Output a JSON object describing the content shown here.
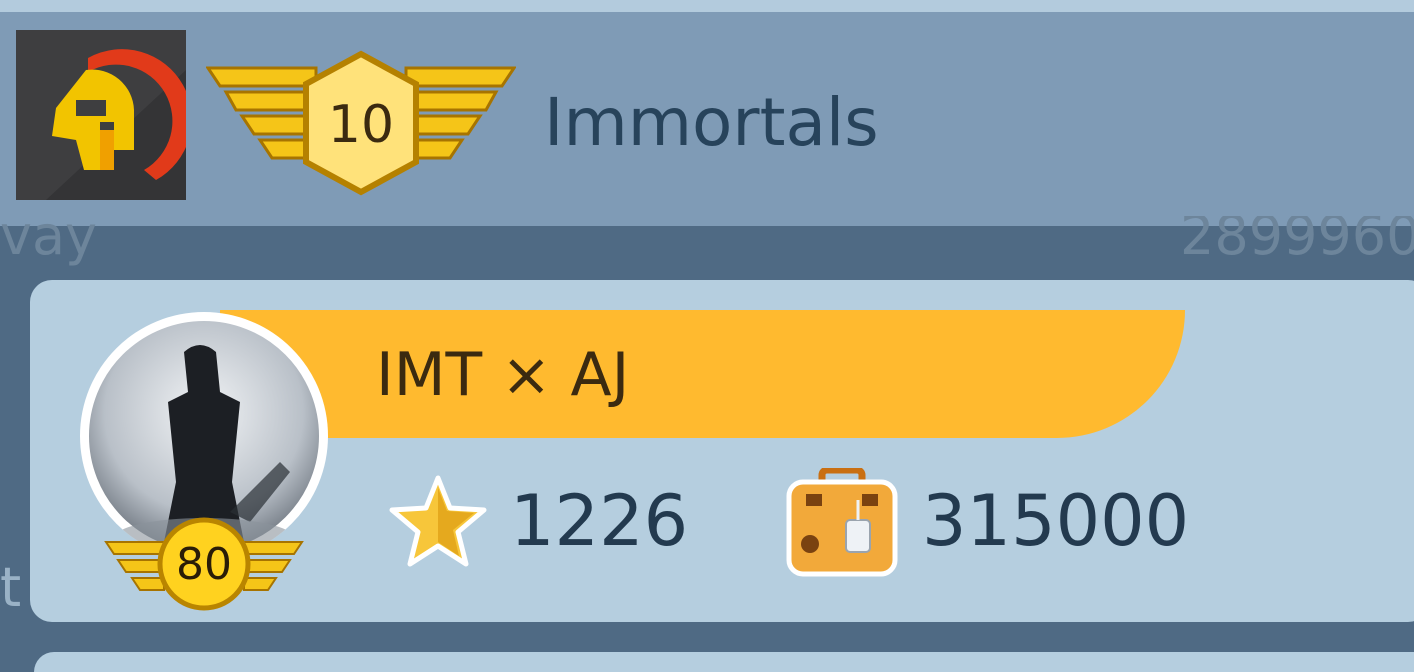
{
  "team": {
    "name": "Immortals",
    "level": "10",
    "logo_icon": "spartan-helmet-icon"
  },
  "background_text": {
    "left": "vay",
    "right": "2899960",
    "left_lower": "t"
  },
  "member": {
    "name": "IMT × AJ",
    "level": "80",
    "trophies": "1226",
    "coins": "315000",
    "avatar_icon": "hooded-figure-avatar",
    "trophy_icon": "star-icon",
    "coins_icon": "suitcase-icon"
  },
  "colors": {
    "header_bg": "#7f9bb6",
    "card_bg": "#b5cedf",
    "banner": "#ffba2f",
    "text_dark": "#233a4f"
  }
}
